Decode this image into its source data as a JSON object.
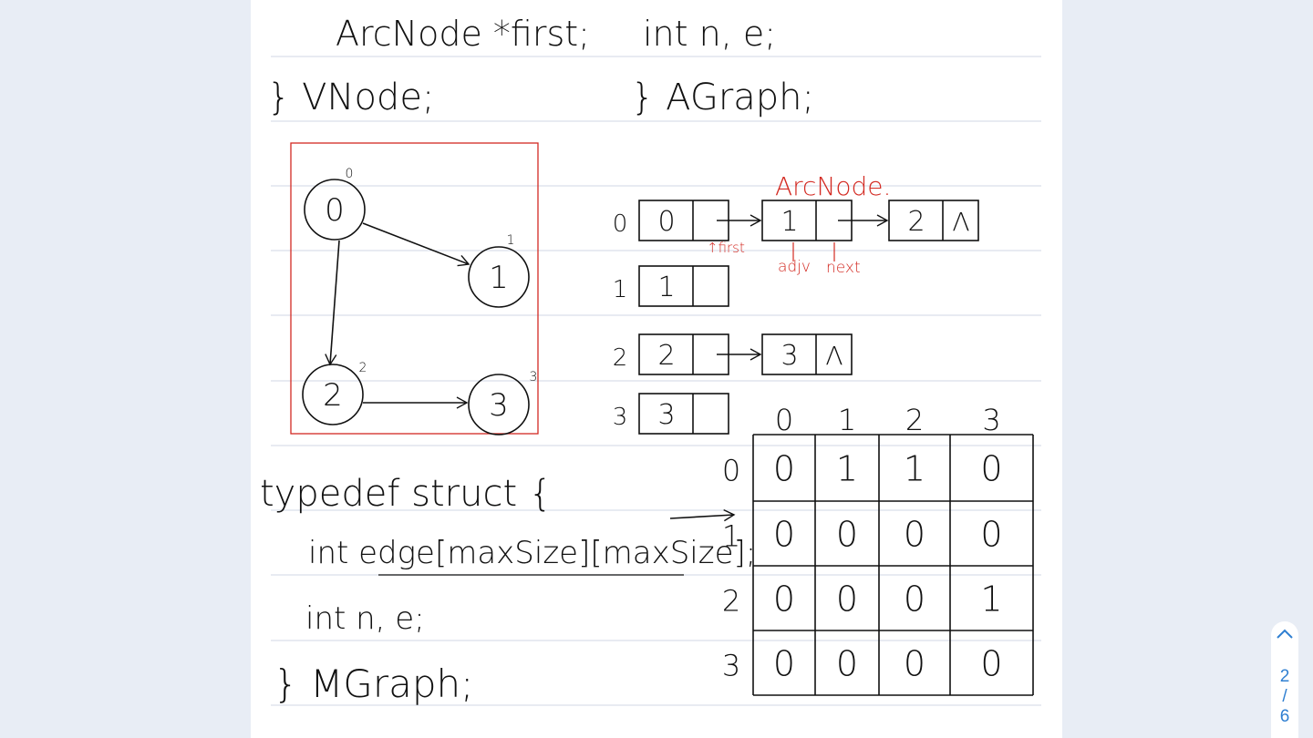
{
  "notes": {
    "line1_left": "ArcNode *first;",
    "line1_right": "int n, e;",
    "line2_left": "} VNode;",
    "line2_right": "} AGraph;",
    "arcnode_label": "ArcNode.",
    "first_label": "↑first",
    "adjv_label": "adjv",
    "next_label": "next",
    "null_symbol": "Λ",
    "graph_nodes": [
      "0",
      "1",
      "2",
      "3"
    ],
    "list_rows": [
      {
        "index": "0",
        "vertex": "0",
        "arcs": [
          "1",
          "2"
        ]
      },
      {
        "index": "1",
        "vertex": "1",
        "arcs": []
      },
      {
        "index": "2",
        "vertex": "2",
        "arcs": [
          "3"
        ]
      },
      {
        "index": "3",
        "vertex": "3",
        "arcs": []
      }
    ],
    "matrix_col_labels": [
      "0",
      "1",
      "2",
      "3"
    ],
    "matrix_row_labels": [
      "0",
      "1",
      "2",
      "3"
    ],
    "matrix": [
      [
        "0",
        "1",
        "1",
        "0"
      ],
      [
        "0",
        "0",
        "0",
        "0"
      ],
      [
        "0",
        "0",
        "0",
        "1"
      ],
      [
        "0",
        "0",
        "0",
        "0"
      ]
    ],
    "code_typedef": "typedef struct {",
    "code_edge": "int edge[maxSize][maxSize];",
    "code_ne": "int n, e;",
    "code_end": "} MGraph;"
  },
  "pager": {
    "current": "2",
    "separator": "/",
    "total": "6",
    "up_icon": "chevron-up-icon"
  },
  "colors": {
    "background": "#e8edf5",
    "ink": "#111111",
    "red_ink": "#d32a22",
    "accent": "#2f7fd1"
  }
}
